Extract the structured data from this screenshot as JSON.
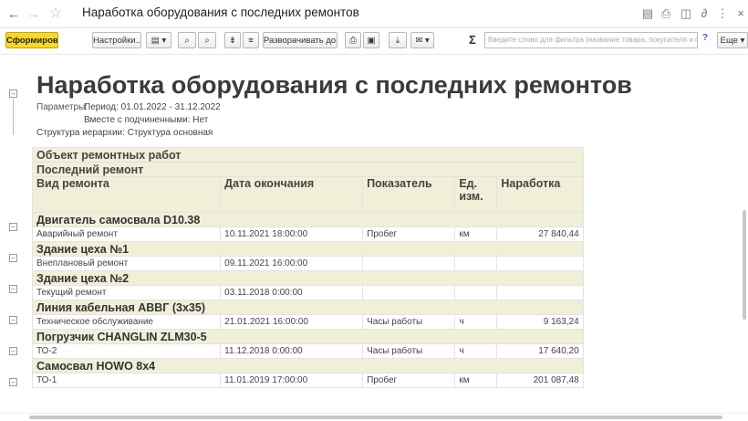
{
  "window": {
    "title": "Наработка оборудования с последних ремонтов",
    "more_dots": "⋮",
    "close_icon": "×"
  },
  "toolbar": {
    "generate": "Сформировать",
    "settings": "Настройки...",
    "expand_to": "Разворачивать до",
    "filter_placeholder": "Введите слово для фильтра (название товара, покупателя и п...)",
    "help": "?",
    "more": "Еще"
  },
  "report": {
    "title": "Наработка оборудования с последних ремонтов",
    "params_label": "Параметры:",
    "params": [
      "Период: 01.01.2022 - 31.12.2022",
      "Вместе с подчиненными: Нет",
      "Структура иерархии: Структура основная"
    ],
    "header": {
      "object": "Объект ремонтных работ",
      "last_repair": "Последний ремонт",
      "repair_type": "Вид ремонта",
      "end_date": "Дата окончания",
      "indicator": "Показатель",
      "unit_line1": "Ед.",
      "unit_line2": "изм.",
      "runtime": "Наработка"
    },
    "groups": [
      {
        "name": "Двигатель самосвала D10.38",
        "type": "Аварийный ремонт",
        "date": "10.11.2021 18:00:00",
        "indicator": "Пробег",
        "unit": "км",
        "value": "27 840,44"
      },
      {
        "name": "Здание цеха №1",
        "type": "Внеплановый ремонт",
        "date": "09.11.2021 16:00:00",
        "indicator": "",
        "unit": "",
        "value": ""
      },
      {
        "name": "Здание цеха №2",
        "type": "Текущий ремонт",
        "date": "03.11.2018 0:00:00",
        "indicator": "",
        "unit": "",
        "value": ""
      },
      {
        "name": "Линия кабельная АВВГ (3х35)",
        "type": "Техническое обслуживание",
        "date": "21.01.2021 16:00:00",
        "indicator": "Часы работы",
        "unit": "ч",
        "value": "9 163,24"
      },
      {
        "name": "Погрузчик CHANGLIN ZLM30-5",
        "type": "ТО-2",
        "date": "11.12.2018 0:00:00",
        "indicator": "Часы работы",
        "unit": "ч",
        "value": "17 640,20"
      },
      {
        "name": "Самосвал HOWO 8x4",
        "type": "ТО-1",
        "date": "11.01.2019 17:00:00",
        "indicator": "Пробег",
        "unit": "км",
        "value": "201 087,48"
      }
    ]
  }
}
